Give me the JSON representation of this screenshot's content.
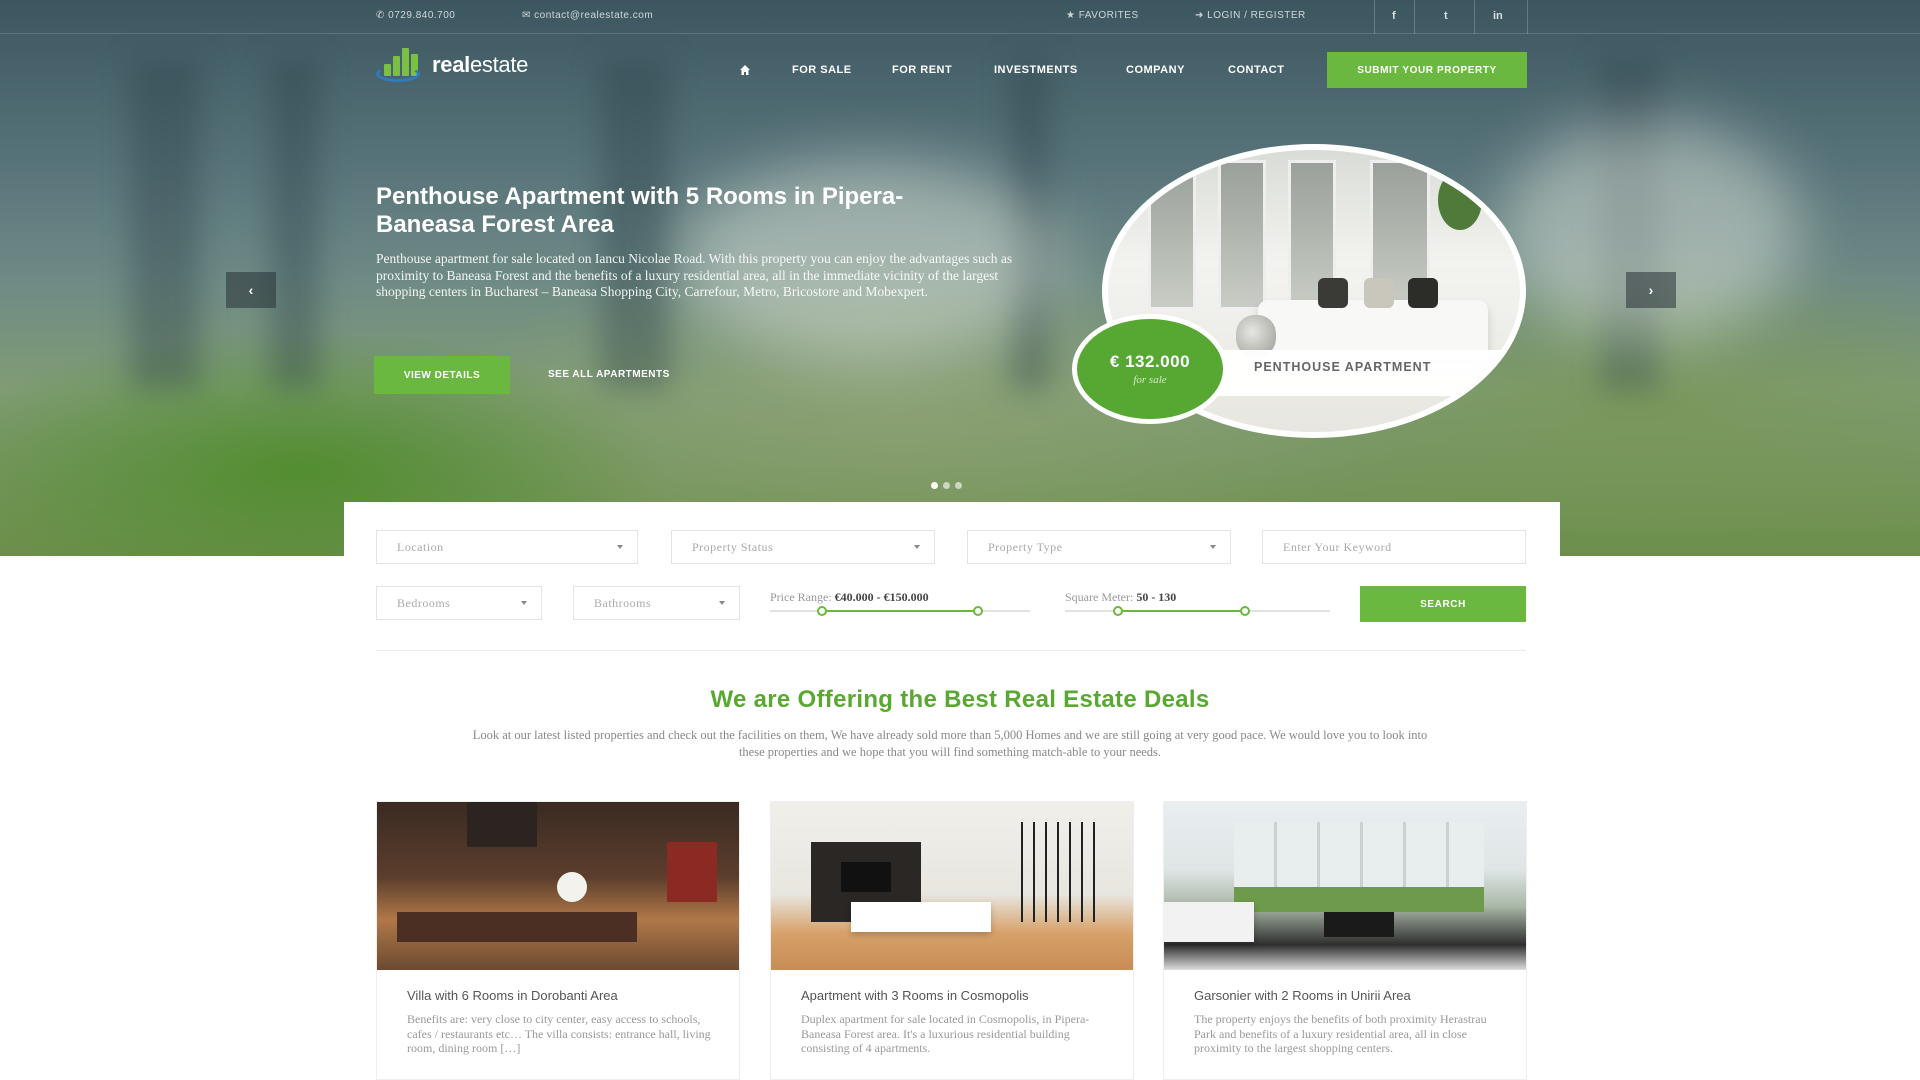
{
  "topbar": {
    "phone": "0729.840.700",
    "email": "contact@realestate.com",
    "favorites": "FAVORITES",
    "login": "LOGIN / REGISTER",
    "social": [
      "f",
      "t",
      "in"
    ]
  },
  "logo": {
    "text_bold": "real",
    "text_light": "estate"
  },
  "nav": {
    "items": [
      "FOR SALE",
      "FOR RENT",
      "INVESTMENTS",
      "COMPANY",
      "CONTACT"
    ],
    "submit_label": "SUBMIT YOUR PROPERTY"
  },
  "hero": {
    "title": "Penthouse Apartment with 5 Rooms in Pipera-Baneasa Forest Area",
    "text": "Penthouse apartment for sale located on Iancu Nicolae Road. With this property you can enjoy the advantages such as proximity to Baneasa Forest and the benefits of a luxury residential area, all in the immediate vicinity of the largest shopping centers in Bucharest – Baneasa Shopping City, Carrefour, Metro, Bricostore and Mobexpert.",
    "details_label": "VIEW DETAILS",
    "all_label": "SEE ALL APARTMENTS",
    "prev_glyph": "‹",
    "next_glyph": "›",
    "price": "€ 132.000",
    "price_note": "for sale",
    "property_label": "PENTHOUSE APARTMENT",
    "slide_count": 3,
    "active_slide": 1
  },
  "search": {
    "location": "Location",
    "status": "Property Status",
    "type": "Property Type",
    "keyword_placeholder": "Enter Your Keyword",
    "bedrooms": "Bedrooms",
    "bathrooms": "Bathrooms",
    "price_label": "Price Range:",
    "price_value": "€40.000 - €150.000",
    "price_range": [
      0.2,
      0.8
    ],
    "sqm_label": "Square Meter:",
    "sqm_value": "50 - 130",
    "sqm_range": [
      0.2,
      0.68
    ],
    "button": "SEARCH"
  },
  "offering": {
    "title": "We are Offering the Best Real Estate Deals",
    "text": "Look at our latest listed properties and check out the facilities on them, We have already sold more than 5,000 Homes and we are still going at very good pace. We would love you to look into these properties and we hope that you will find something match-able to your needs."
  },
  "cards": [
    {
      "title": "Villa with 6 Rooms in Dorobanti Area",
      "text": "Benefits are: very close to city center, easy access to schools, cafes / restaurants etc… The villa consists: entrance hall, living room, dining room […]"
    },
    {
      "title": "Apartment with 3 Rooms in Cosmopolis",
      "text": "Duplex apartment for sale located in Cosmopolis, in Pipera-Baneasa Forest area. It's a luxurious residential building consisting of 4 apartments."
    },
    {
      "title": "Garsonier with 2 Rooms in Unirii Area",
      "text": "The property enjoys the benefits of both proximity Herastrau Park and benefits of a luxury residential area, all in close proximity to the largest shopping centers."
    }
  ],
  "colors": {
    "accent": "#6ab83f",
    "accent_dark": "#56a833",
    "logo_blue": "#2e7bbf"
  }
}
